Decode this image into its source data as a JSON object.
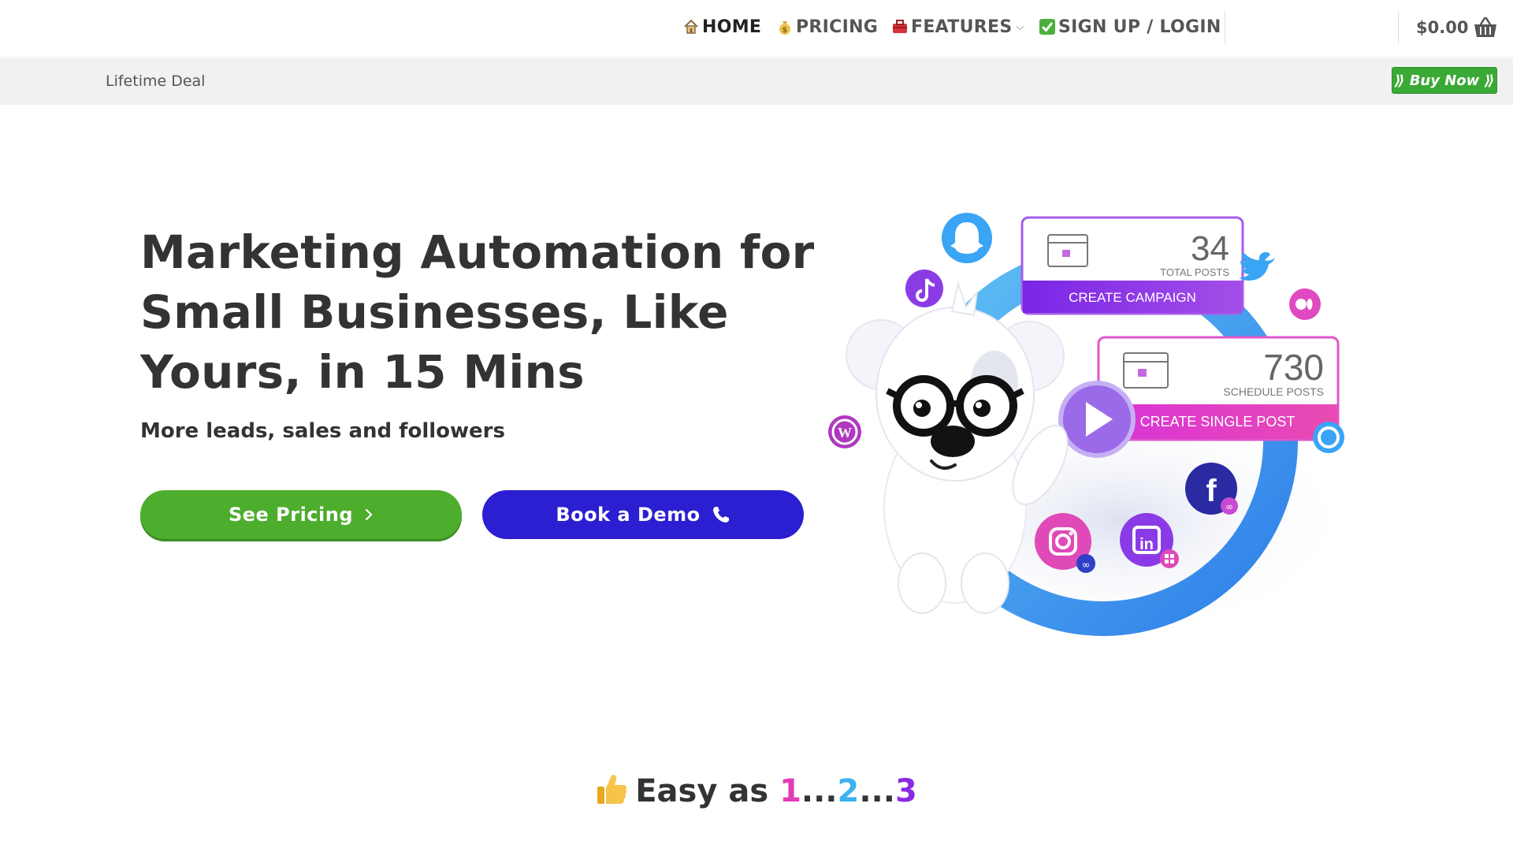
{
  "nav": {
    "home": "HOME",
    "pricing": "PRICING",
    "features": "FEATURES",
    "signup": "SIGN UP / LOGIN",
    "cart_total": "$0.00",
    "icons": {
      "home": "house-emoji",
      "pricing": "money-bag-emoji",
      "features": "toolbox-emoji",
      "signup": "check-mark-emoji",
      "cart": "basket-icon",
      "features_caret": "chevron-down-icon"
    }
  },
  "promo": {
    "label": "Lifetime Deal",
    "button": "⟫ Buy Now ⟫"
  },
  "hero": {
    "title": "Marketing Automation for Small Businesses, Like Yours, in 15 Mins",
    "subtitle": "More leads, sales and followers",
    "primary_cta": "See Pricing",
    "secondary_cta": "Book a Demo"
  },
  "illustration": {
    "card1": {
      "number": "34",
      "caption": "TOTAL POSTS",
      "button": "CREATE CAMPAIGN"
    },
    "card2": {
      "number": "730",
      "caption": "SCHEDULE POSTS",
      "button": "CREATE SINGLE POST"
    },
    "icons": [
      "snapchat-icon",
      "tiktok-icon",
      "twitter-icon",
      "medium-icon",
      "wordpress-icon",
      "play-icon",
      "facebook-icon",
      "instagram-icon",
      "linkedin-icon",
      "alexa-icon",
      "dog-mascot"
    ]
  },
  "section": {
    "easy_prefix": "Easy as ",
    "n1": "1",
    "dots1": "...",
    "n2": "2",
    "dots2": "...",
    "n3": "3"
  },
  "colors": {
    "green": "#4dad2c",
    "blue": "#2b1fd1",
    "purple": "#8a2be2",
    "pink": "#e23bb8",
    "sky": "#3db2f0"
  }
}
